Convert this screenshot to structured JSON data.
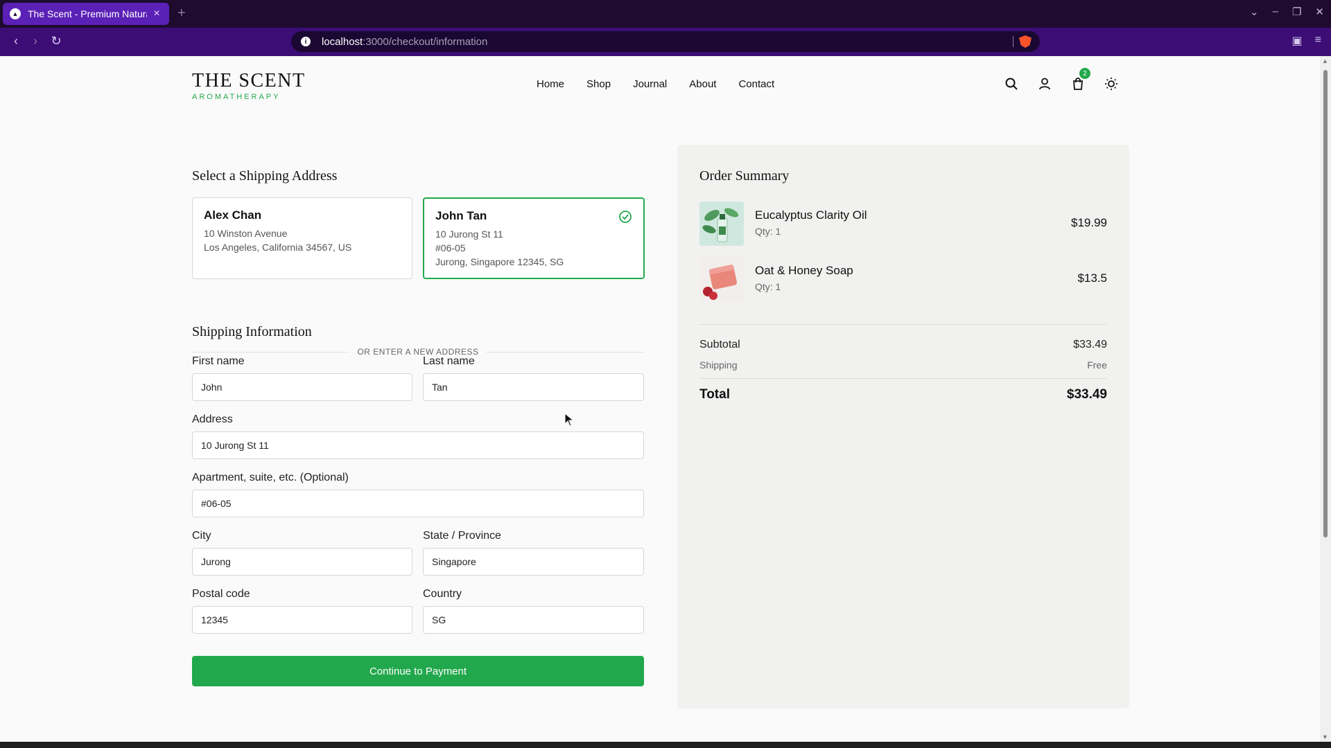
{
  "browser": {
    "tab_title": "The Scent - Premium Natura",
    "url_host": "localhost",
    "url_rest": ":3000/checkout/information"
  },
  "header": {
    "logo_main": "THE SCENT",
    "logo_sub": "AROMATHERAPY",
    "nav": [
      "Home",
      "Shop",
      "Journal",
      "About",
      "Contact"
    ],
    "cart_count": "2"
  },
  "shipping_select": {
    "title": "Select a Shipping Address",
    "addresses": [
      {
        "name": "Alex Chan",
        "line1": "10 Winston Avenue",
        "line2": "Los Angeles, California 34567, US",
        "line3": ""
      },
      {
        "name": "John Tan",
        "line1": "10 Jurong St 11",
        "line2": "#06-05",
        "line3": "Jurong, Singapore 12345, SG",
        "selected": true
      }
    ],
    "divider": "OR ENTER A NEW ADDRESS"
  },
  "form": {
    "title": "Shipping Information",
    "first_name_label": "First name",
    "first_name": "John",
    "last_name_label": "Last name",
    "last_name": "Tan",
    "address_label": "Address",
    "address": "10 Jurong St 11",
    "apartment_label": "Apartment, suite, etc. (Optional)",
    "apartment": "#06-05",
    "city_label": "City",
    "city": "Jurong",
    "state_label": "State / Province",
    "state": "Singapore",
    "postal_label": "Postal code",
    "postal": "12345",
    "country_label": "Country",
    "country": "SG",
    "continue_label": "Continue to Payment"
  },
  "summary": {
    "title": "Order Summary",
    "items": [
      {
        "name": "Eucalyptus Clarity Oil",
        "qty": "Qty: 1",
        "price": "$19.99"
      },
      {
        "name": "Oat & Honey Soap",
        "qty": "Qty: 1",
        "price": "$13.5"
      }
    ],
    "subtotal_label": "Subtotal",
    "subtotal": "$33.49",
    "shipping_label": "Shipping",
    "shipping": "Free",
    "total_label": "Total",
    "total": "$33.49"
  },
  "colors": {
    "accent": "#22a84c",
    "tabbar": "#1e0b2e",
    "addressbar": "#3b0d75"
  }
}
